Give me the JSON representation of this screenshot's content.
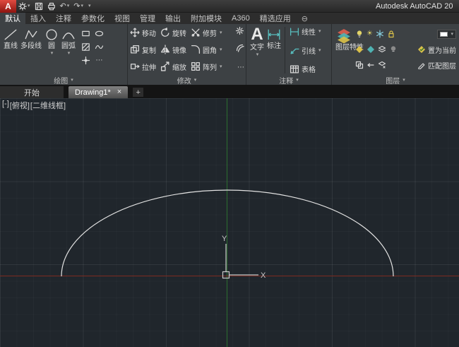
{
  "titlebar": {
    "logo_letter": "A",
    "app_title": "Autodesk AutoCAD 20"
  },
  "icons": {
    "chevron_down": "▾",
    "close": "×",
    "new_tab": "+",
    "undo": "↶",
    "redo": "↷",
    "collapse": "⊖",
    "sun": "☀",
    "ellipsis": "⋯",
    "text_glyph": "A"
  },
  "ribbon": {
    "tabs": [
      {
        "label": "默认",
        "active": true
      },
      {
        "label": "插入"
      },
      {
        "label": "注释"
      },
      {
        "label": "参数化"
      },
      {
        "label": "视图"
      },
      {
        "label": "管理"
      },
      {
        "label": "输出"
      },
      {
        "label": "附加模块"
      },
      {
        "label": "A360"
      },
      {
        "label": "精选应用"
      }
    ],
    "draw": {
      "title": "绘图",
      "line": "直线",
      "polyline": "多段线",
      "circle": "圆",
      "arc": "圆弧"
    },
    "modify": {
      "title": "修改",
      "move": "移动",
      "rotate": "旋转",
      "trim": "修剪",
      "copy": "复制",
      "mirror": "镜像",
      "fillet": "圆角",
      "stretch": "拉伸",
      "scale": "缩放",
      "array": "阵列"
    },
    "annotate": {
      "title": "注释",
      "text": "文字",
      "dimension": "标注",
      "linear": "线性",
      "leader": "引线",
      "table": "表格"
    },
    "layers": {
      "title": "图层",
      "properties": "图层特性",
      "set_current": "置为当前",
      "match": "匹配图层"
    }
  },
  "file_tabs": {
    "start": "开始",
    "drawing": "Drawing1*"
  },
  "canvas": {
    "controls": [
      "[-]",
      "[俯视]",
      "[二维线框]"
    ],
    "ucs_x": "X",
    "ucs_y": "Y"
  }
}
